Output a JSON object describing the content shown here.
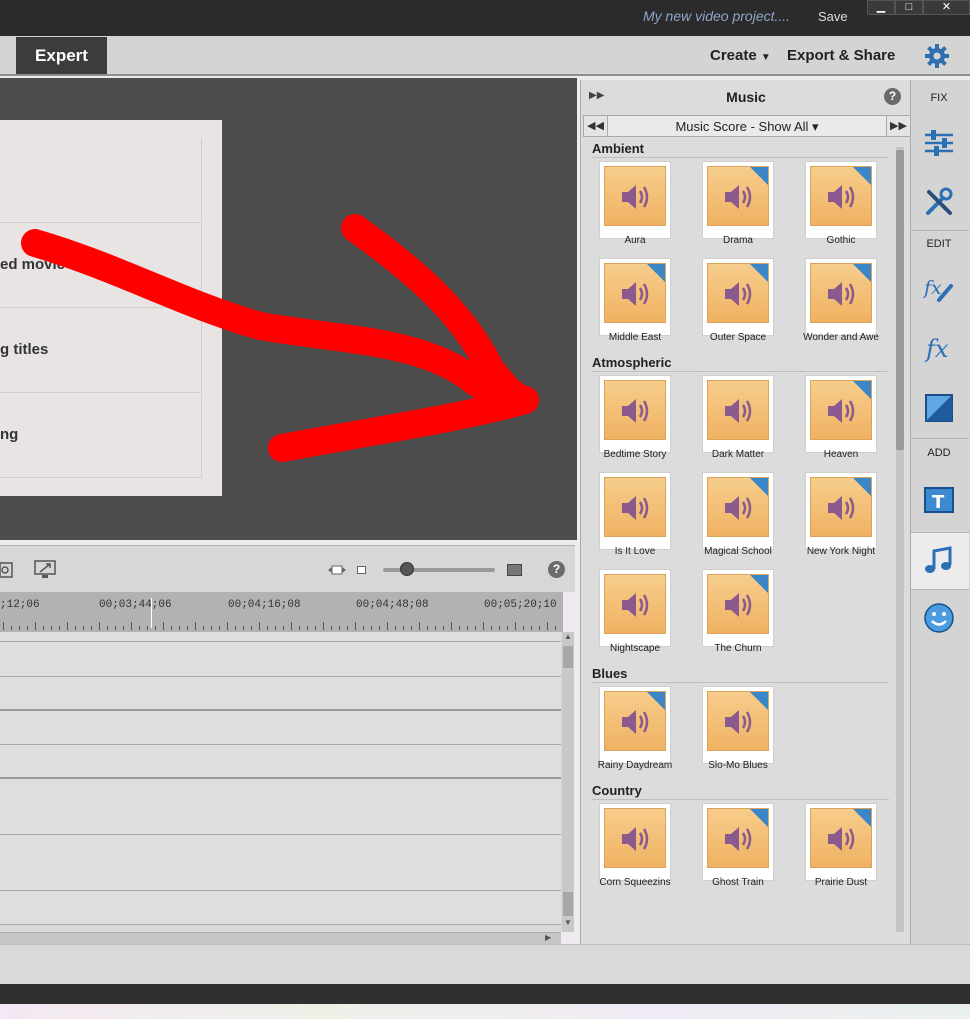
{
  "title_bar": {
    "project_name": "My new video project....",
    "save_label": "Save",
    "window_buttons": [
      "▁",
      "□",
      "✕"
    ]
  },
  "toolbar": {
    "expert_tab": "Expert",
    "create_menu": "Create",
    "export_menu": "Export & Share",
    "settings_icon": "gear-icon"
  },
  "preview": {
    "rows": [
      "",
      "ed movie",
      "g titles",
      "ng"
    ],
    "annotation_color": "#ff0000"
  },
  "timeline": {
    "timecodes": [
      ";12;06",
      "00;03;44;06",
      "00;04;16;08",
      "00;04;48;08",
      "00;05;20;10"
    ]
  },
  "music_panel": {
    "title": "Music",
    "dropdown_label": "Music Score - Show All ▾",
    "categories": [
      {
        "name": "Ambient",
        "tracks": [
          "Aura",
          "Drama",
          "Gothic",
          "Middle East",
          "Outer Space",
          "Wonder and Awe"
        ]
      },
      {
        "name": "Atmospheric",
        "tracks": [
          "Bedtime Story",
          "Dark Matter",
          "Heaven",
          "Is It Love",
          "Magical School",
          "New York Night",
          "Nightscape",
          "The Churn"
        ]
      },
      {
        "name": "Blues",
        "tracks": [
          "Rainy Daydream",
          "Slo-Mo Blues"
        ]
      },
      {
        "name": "Country",
        "tracks": [
          "Corn Squeezins",
          "Ghost Train",
          "Prairie Dust"
        ]
      }
    ]
  },
  "sidebar": {
    "fix_label": "FIX",
    "edit_label": "EDIT",
    "add_label": "ADD"
  },
  "colors": {
    "thumb_orange": "#f2b86b",
    "speaker_purple": "#8a5a8e",
    "new_corner_blue": "#3b86c6",
    "sidebar_icon_blue": "#2b6fb5"
  }
}
